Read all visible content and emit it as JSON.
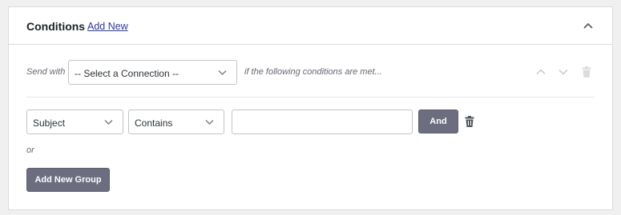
{
  "header": {
    "title": "Conditions",
    "add_new_label": "Add New"
  },
  "rule": {
    "send_with_label": "Send with",
    "connection_select_value": "-- Select a Connection --",
    "conditions_text": "if the following conditions are met..."
  },
  "condition": {
    "field_value": "Subject",
    "operator_value": "Contains",
    "value_input": "",
    "and_label": "And"
  },
  "or_label": "or",
  "add_group_label": "Add New Group",
  "colors": {
    "button_bg": "#6c6e80",
    "link": "#2a38a7",
    "border": "#dcdcde"
  },
  "icons": {
    "collapse": "chevron-up-icon",
    "move_up": "chevron-up-icon",
    "move_down": "chevron-down-icon",
    "delete": "trash-icon",
    "dropdown": "chevron-down-icon"
  }
}
